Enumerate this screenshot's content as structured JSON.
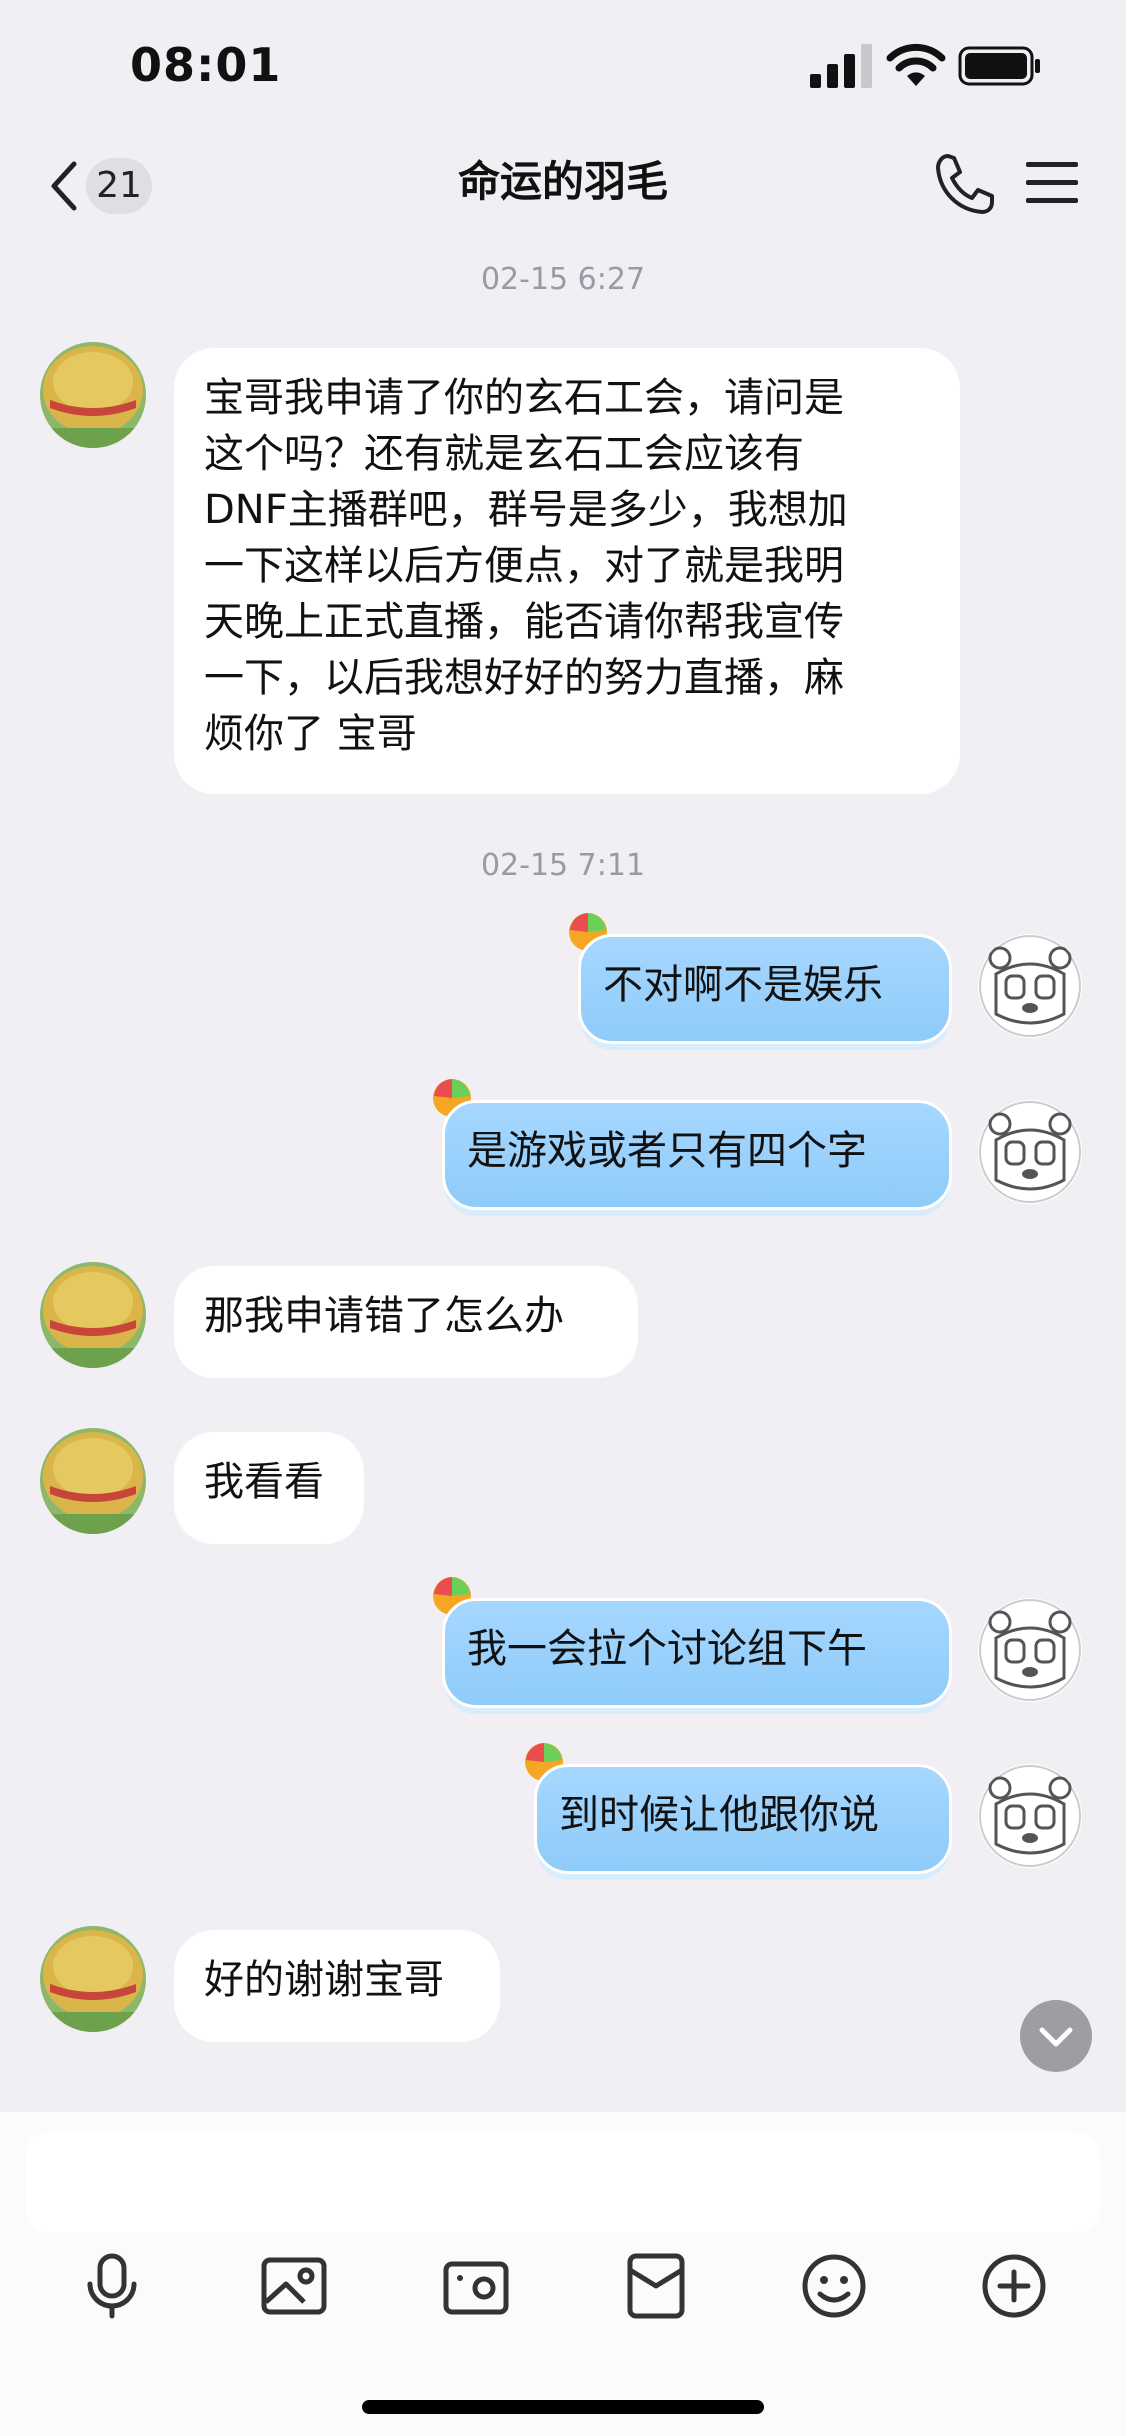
{
  "status": {
    "time": "08:01"
  },
  "nav": {
    "unread_count": "21",
    "title": "命运的羽毛"
  },
  "messages": [
    {
      "type": "timestamp",
      "text": "02-15 6:27"
    },
    {
      "type": "in",
      "lines": [
        "宝哥我申请了你的玄石工会，请问是",
        "这个吗？还有就是玄石工会应该有",
        "DNF主播群吧，群号是多少，我想加",
        "一下这样以后方便点，对了就是我明",
        "天晚上正式直播，能否请你帮我宣传",
        "一下，以后我想好好的努力直播，麻",
        "烦你了 宝哥"
      ]
    },
    {
      "type": "timestamp",
      "text": "02-15 7:11"
    },
    {
      "type": "out",
      "text": "不对啊不是娱乐"
    },
    {
      "type": "out",
      "text": "是游戏或者只有四个字"
    },
    {
      "type": "in",
      "text": "那我申请错了怎么办"
    },
    {
      "type": "in",
      "text": "我看看"
    },
    {
      "type": "out",
      "text": "我一会拉个讨论组下午"
    },
    {
      "type": "out",
      "text": "到时候让他跟你说"
    },
    {
      "type": "in",
      "text": "好的谢谢宝哥"
    }
  ],
  "toolbar": [
    "microphone-icon",
    "image-icon",
    "camera-icon",
    "red-packet-icon",
    "emoji-icon",
    "plus-icon"
  ],
  "colors": {
    "background": "#f1eff3",
    "incoming_bubble": "#ffffff",
    "outgoing_bubble": "#9fd3fd"
  }
}
